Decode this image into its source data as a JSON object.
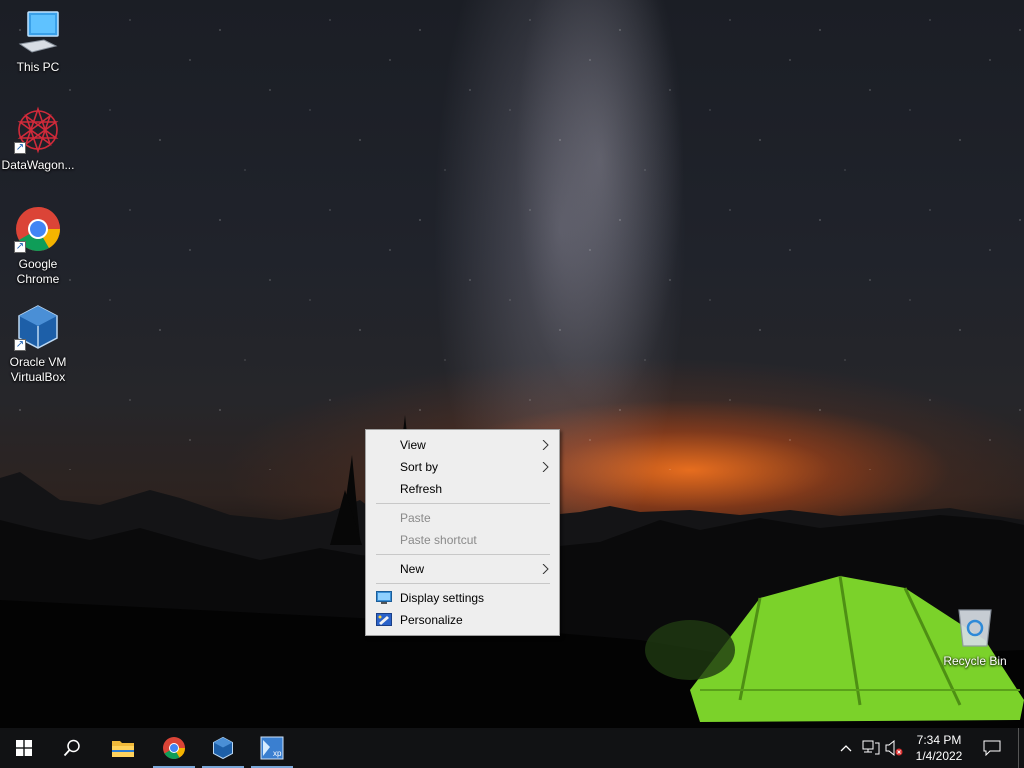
{
  "desktop": {
    "icons": [
      {
        "label": "This PC",
        "icon": "computer-icon",
        "shortcut": false
      },
      {
        "label": "DataWagon...",
        "icon": "datawagon-icon",
        "shortcut": true
      },
      {
        "label": "Google Chrome",
        "icon": "chrome-icon",
        "shortcut": true
      },
      {
        "label": "Oracle VM VirtualBox",
        "icon": "virtualbox-icon",
        "shortcut": true
      },
      {
        "label": "Recycle Bin",
        "icon": "recycle-bin-icon",
        "shortcut": false
      }
    ]
  },
  "context_menu": {
    "items": [
      {
        "label": "View",
        "submenu": true,
        "enabled": true
      },
      {
        "label": "Sort by",
        "submenu": true,
        "enabled": true
      },
      {
        "label": "Refresh",
        "submenu": false,
        "enabled": true
      },
      {
        "label": "Paste",
        "submenu": false,
        "enabled": false
      },
      {
        "label": "Paste shortcut",
        "submenu": false,
        "enabled": false
      },
      {
        "label": "New",
        "submenu": true,
        "enabled": true
      },
      {
        "label": "Display settings",
        "submenu": false,
        "enabled": true,
        "icon": "display-icon"
      },
      {
        "label": "Personalize",
        "submenu": false,
        "enabled": true,
        "icon": "personalize-icon"
      }
    ]
  },
  "taskbar": {
    "apps": [
      {
        "name": "File Explorer",
        "icon": "folder-icon",
        "running": false
      },
      {
        "name": "Google Chrome",
        "icon": "chrome-icon",
        "running": true
      },
      {
        "name": "Oracle VM VirtualBox",
        "icon": "virtualbox-icon",
        "running": true
      },
      {
        "name": "Windows XP VM",
        "icon": "xp-vm-icon",
        "running": true
      }
    ],
    "clock": {
      "time": "7:34 PM",
      "date": "1/4/2022"
    }
  },
  "colors": {
    "taskbar_bg": "#111214",
    "menu_bg": "#eeeeee",
    "menu_disabled_text": "#8a8a8a",
    "running_indicator": "#7aa7d8",
    "tent_green": "#7bd22a"
  }
}
